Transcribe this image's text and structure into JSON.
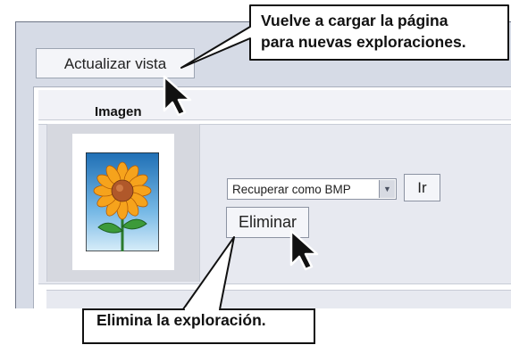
{
  "toolbar": {
    "refresh_label": "Actualizar vista"
  },
  "table": {
    "column_header": "Imagen",
    "row": {
      "action_select_value": "Recuperar como BMP",
      "go_label": "Ir",
      "delete_label": "Eliminar"
    }
  },
  "callouts": {
    "refresh_line1": "Vuelve a cargar la página",
    "refresh_line2": "para nuevas exploraciones.",
    "delete_text": "Elimina la exploración."
  },
  "icons": {
    "dropdown_arrow": "chevron-down-icon",
    "pointer": "mouse-pointer-icon"
  }
}
